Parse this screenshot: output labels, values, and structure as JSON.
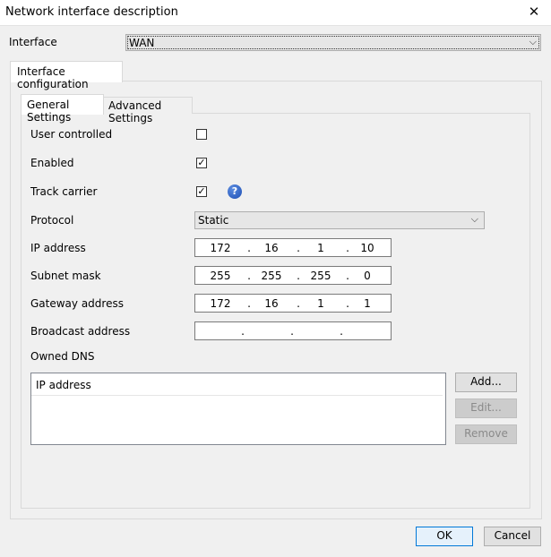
{
  "window": {
    "title": "Network interface description",
    "close_glyph": "✕"
  },
  "interface": {
    "label": "Interface",
    "value": "WAN"
  },
  "outer_tab": {
    "label": "Interface configuration"
  },
  "tabs": [
    {
      "label": "General Settings"
    },
    {
      "label": "Advanced Settings"
    }
  ],
  "fields": {
    "user_controlled": {
      "label": "User controlled",
      "checked": false
    },
    "enabled": {
      "label": "Enabled",
      "checked": true,
      "mark": "✓"
    },
    "track_carrier": {
      "label": "Track carrier",
      "checked": true,
      "mark": "✓",
      "help_glyph": "?"
    },
    "protocol": {
      "label": "Protocol",
      "value": "Static"
    },
    "ip_address": {
      "label": "IP address",
      "octets": [
        "172",
        "16",
        "1",
        "10"
      ]
    },
    "subnet_mask": {
      "label": "Subnet mask",
      "octets": [
        "255",
        "255",
        "255",
        "0"
      ]
    },
    "gateway": {
      "label": "Gateway address",
      "octets": [
        "172",
        "16",
        "1",
        "1"
      ]
    },
    "broadcast": {
      "label": "Broadcast address",
      "octets": [
        "",
        "",
        "",
        ""
      ]
    }
  },
  "dns": {
    "label": "Owned DNS",
    "column_header": "IP address",
    "add": "Add...",
    "edit": "Edit...",
    "remove": "Remove"
  },
  "footer": {
    "ok": "OK",
    "cancel": "Cancel"
  },
  "chevron_glyph": "⌵",
  "dot": "."
}
